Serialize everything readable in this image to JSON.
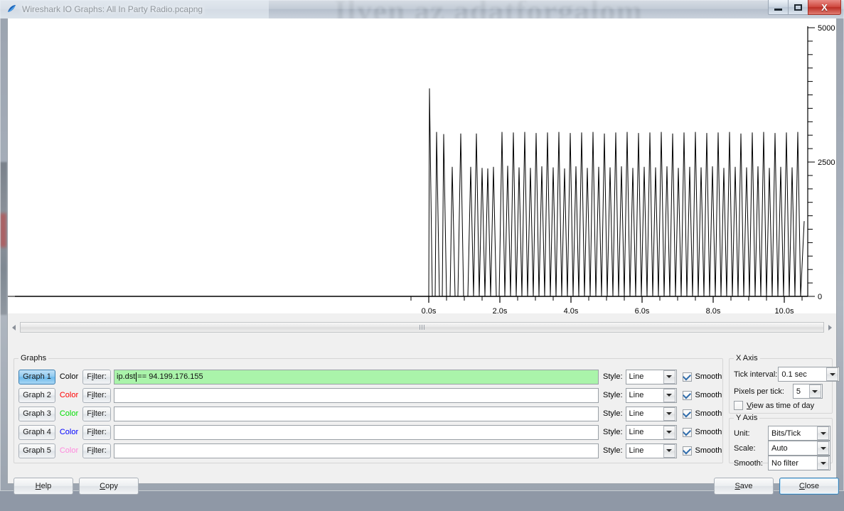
{
  "window": {
    "title": "Wireshark IO Graphs: All In Party Radio.pcapng",
    "app_icon": "wireshark-fin-icon",
    "minimize_label": "–",
    "maximize_label": "□",
    "close_label": "X"
  },
  "desktop": {
    "background_text": "Ilyen az adatforgalom"
  },
  "chart_data": {
    "type": "line",
    "title": "",
    "xlabel": "",
    "ylabel": "",
    "unit": "Bits/Tick",
    "xlim": [
      -12.0,
      10.6
    ],
    "ylim": [
      0,
      5000
    ],
    "grid": false,
    "legend": null,
    "x_ticks_major": [
      "0.0s",
      "2.0s",
      "4.0s",
      "6.0s",
      "8.0s",
      "10.0s"
    ],
    "x_tick_values": [
      0.0,
      2.0,
      4.0,
      6.0,
      8.0,
      10.0
    ],
    "x_minor_tick_step": 0.5,
    "y_ticks_major": [
      "0",
      "2500",
      "5000"
    ],
    "y_tick_values": [
      0,
      2500,
      5000
    ],
    "y_minor_tick_step": 250,
    "series": [
      {
        "name": "Graph 1",
        "color": "#000000",
        "note": "Bursty periodic traffic; flat zero before t=0.02s, then repeating narrow spikes to ~2400-3900 bits/tick returning to 0 between bursts.",
        "x": [
          -12.0,
          0.0,
          0.02,
          0.1,
          0.18,
          0.22,
          0.3,
          0.38,
          0.42,
          0.5,
          0.6,
          0.66,
          0.74,
          0.82,
          0.9,
          0.98,
          1.06,
          1.1,
          1.18,
          1.26,
          1.34,
          1.42,
          1.5,
          1.58,
          1.66,
          1.74,
          1.82,
          1.9,
          1.98,
          2.06,
          2.14,
          2.22,
          2.3,
          2.38,
          2.46,
          2.54,
          2.62,
          2.7,
          2.78,
          2.86,
          2.94,
          3.02,
          3.1,
          3.18,
          3.26,
          3.34,
          3.42,
          3.5,
          3.58,
          3.66,
          3.74,
          3.82,
          3.9,
          3.98,
          4.06,
          4.14,
          4.22,
          4.3,
          4.38,
          4.46,
          4.54,
          4.62,
          4.7,
          4.78,
          4.86,
          4.94,
          5.02,
          5.1,
          5.18,
          5.26,
          5.34,
          5.42,
          5.5,
          5.58,
          5.66,
          5.74,
          5.82,
          5.9,
          5.98,
          6.06,
          6.14,
          6.22,
          6.3,
          6.38,
          6.46,
          6.54,
          6.62,
          6.7,
          6.78,
          6.86,
          6.94,
          7.02,
          7.1,
          7.18,
          7.26,
          7.34,
          7.42,
          7.5,
          7.58,
          7.66,
          7.74,
          7.82,
          7.9,
          7.98,
          8.06,
          8.14,
          8.22,
          8.3,
          8.38,
          8.46,
          8.54,
          8.62,
          8.7,
          8.78,
          8.86,
          8.94,
          9.02,
          9.1,
          9.18,
          9.26,
          9.34,
          9.42,
          9.5,
          9.58,
          9.66,
          9.74,
          9.82,
          9.9,
          9.98,
          10.06,
          10.14,
          10.22,
          10.3,
          10.38,
          10.46,
          10.56
        ],
        "y": [
          0,
          0,
          3870,
          0,
          0,
          3060,
          0,
          0,
          3020,
          0,
          0,
          2410,
          0,
          0,
          3030,
          0,
          0,
          0,
          2410,
          0,
          3030,
          0,
          2390,
          0,
          2380,
          0,
          2410,
          0,
          0,
          3060,
          0,
          2430,
          0,
          3050,
          0,
          2400,
          0,
          3060,
          0,
          2390,
          0,
          3040,
          0,
          2420,
          0,
          3050,
          0,
          2400,
          0,
          3060,
          0,
          2380,
          0,
          3040,
          0,
          2420,
          0,
          3050,
          0,
          2390,
          0,
          3060,
          0,
          2410,
          0,
          3030,
          0,
          2400,
          0,
          3050,
          0,
          2420,
          0,
          3060,
          0,
          2390,
          0,
          3040,
          0,
          2410,
          0,
          3050,
          0,
          2400,
          0,
          3060,
          0,
          2420,
          0,
          3030,
          0,
          2390,
          0,
          3050,
          0,
          2410,
          0,
          3060,
          0,
          2400,
          0,
          3040,
          0,
          2420,
          0,
          3050,
          0,
          2390,
          0,
          3060,
          0,
          2410,
          0,
          3030,
          0,
          2400,
          0,
          3050,
          0,
          2420,
          0,
          3060,
          0,
          2390,
          0,
          3040,
          0,
          2410,
          0,
          3050,
          0,
          2400,
          0,
          3060,
          0,
          1400
        ]
      }
    ]
  },
  "graphs_panel": {
    "title": "Graphs",
    "color_label": "Color",
    "filter_label_prefix": "F",
    "filter_label_mnemonic": "i",
    "filter_label_suffix": "lter:",
    "style_label": "Style:",
    "smooth_label": "Smooth",
    "rows": [
      {
        "button": "Graph 1",
        "color_text": "Color",
        "color_hex": "#000000",
        "filter_button": "Filter:",
        "filter_value_before_caret": "ip.dst",
        "filter_value_after_caret": " == 94.199.176.155",
        "filter_valid": true,
        "active": true,
        "style": "Line",
        "smooth": true
      },
      {
        "button": "Graph 2",
        "color_text": "Color",
        "color_hex": "#ff0000",
        "filter_button": "Filter:",
        "filter_value_before_caret": "",
        "filter_value_after_caret": "",
        "filter_valid": false,
        "active": false,
        "style": "Line",
        "smooth": true
      },
      {
        "button": "Graph 3",
        "color_text": "Color",
        "color_hex": "#00dd00",
        "filter_button": "Filter:",
        "filter_value_before_caret": "",
        "filter_value_after_caret": "",
        "filter_valid": false,
        "active": false,
        "style": "Line",
        "smooth": true
      },
      {
        "button": "Graph 4",
        "color_text": "Color",
        "color_hex": "#0000ff",
        "filter_button": "Filter:",
        "filter_value_before_caret": "",
        "filter_value_after_caret": "",
        "filter_valid": false,
        "active": false,
        "style": "Line",
        "smooth": true
      },
      {
        "button": "Graph 5",
        "color_text": "Color",
        "color_hex": "#ff88dd",
        "filter_button": "Filter:",
        "filter_value_before_caret": "",
        "filter_value_after_caret": "",
        "filter_valid": false,
        "active": false,
        "style": "Line",
        "smooth": true
      }
    ]
  },
  "x_axis": {
    "title": "X Axis",
    "tick_interval_label": "Tick interval:",
    "tick_interval_value": "0.1 sec",
    "pixels_per_tick_label": "Pixels per tick:",
    "pixels_per_tick_value": "5",
    "view_time_of_day_label_mnemonic": "V",
    "view_time_of_day_label_rest": "iew as time of day",
    "view_time_of_day_checked": false
  },
  "y_axis": {
    "title": "Y Axis",
    "unit_label": "Unit:",
    "unit_value": "Bits/Tick",
    "scale_label": "Scale:",
    "scale_value": "Auto",
    "smooth_label": "Smooth:",
    "smooth_value": "No filter"
  },
  "scrollbar": {
    "left_arrow": "left-arrow",
    "right_arrow": "right-arrow"
  },
  "bottom_bar": {
    "help_mnemonic": "H",
    "help_rest": "elp",
    "copy_mnemonic": "C",
    "copy_rest": "opy",
    "save_mnemonic": "S",
    "save_rest": "ave",
    "close_mnemonic": "C",
    "close_rest": "lose"
  }
}
